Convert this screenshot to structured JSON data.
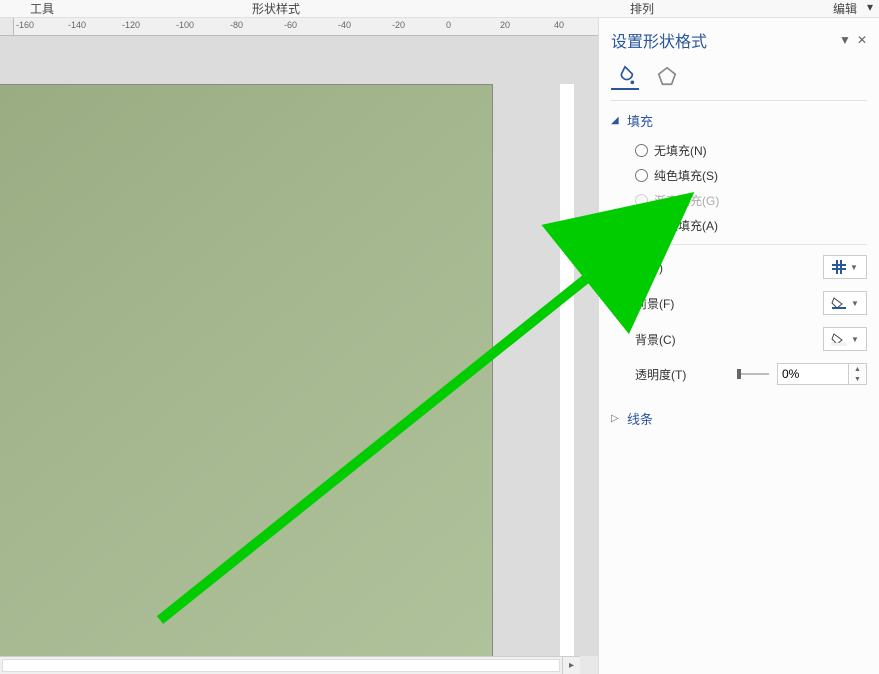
{
  "top_menu": {
    "tools": "工具",
    "style": "形状样式",
    "arrange": "排列",
    "edit": "编辑"
  },
  "ruler": {
    "ticks": [
      {
        "pos": 2,
        "label": "-160"
      },
      {
        "pos": 54,
        "label": "-140"
      },
      {
        "pos": 108,
        "label": "-120"
      },
      {
        "pos": 162,
        "label": "-100"
      },
      {
        "pos": 216,
        "label": "-80"
      },
      {
        "pos": 270,
        "label": "-60"
      },
      {
        "pos": 324,
        "label": "-40"
      },
      {
        "pos": 378,
        "label": "-20"
      },
      {
        "pos": 432,
        "label": "0"
      },
      {
        "pos": 486,
        "label": "20"
      },
      {
        "pos": 540,
        "label": "40"
      }
    ]
  },
  "panel": {
    "title": "设置形状格式",
    "sections": {
      "fill": {
        "label": "填充",
        "options": {
          "none": "无填充(N)",
          "solid": "纯色填充(S)",
          "gradient": "渐变填充(G)",
          "pattern": "图案填充(A)"
        },
        "selected": "pattern",
        "props": {
          "pattern": "式(P)",
          "foreground": "前景(F)",
          "background": "背景(C)",
          "transparency": "透明度(T)",
          "transparency_value": "0%"
        }
      },
      "line": {
        "label": "线条"
      }
    }
  }
}
